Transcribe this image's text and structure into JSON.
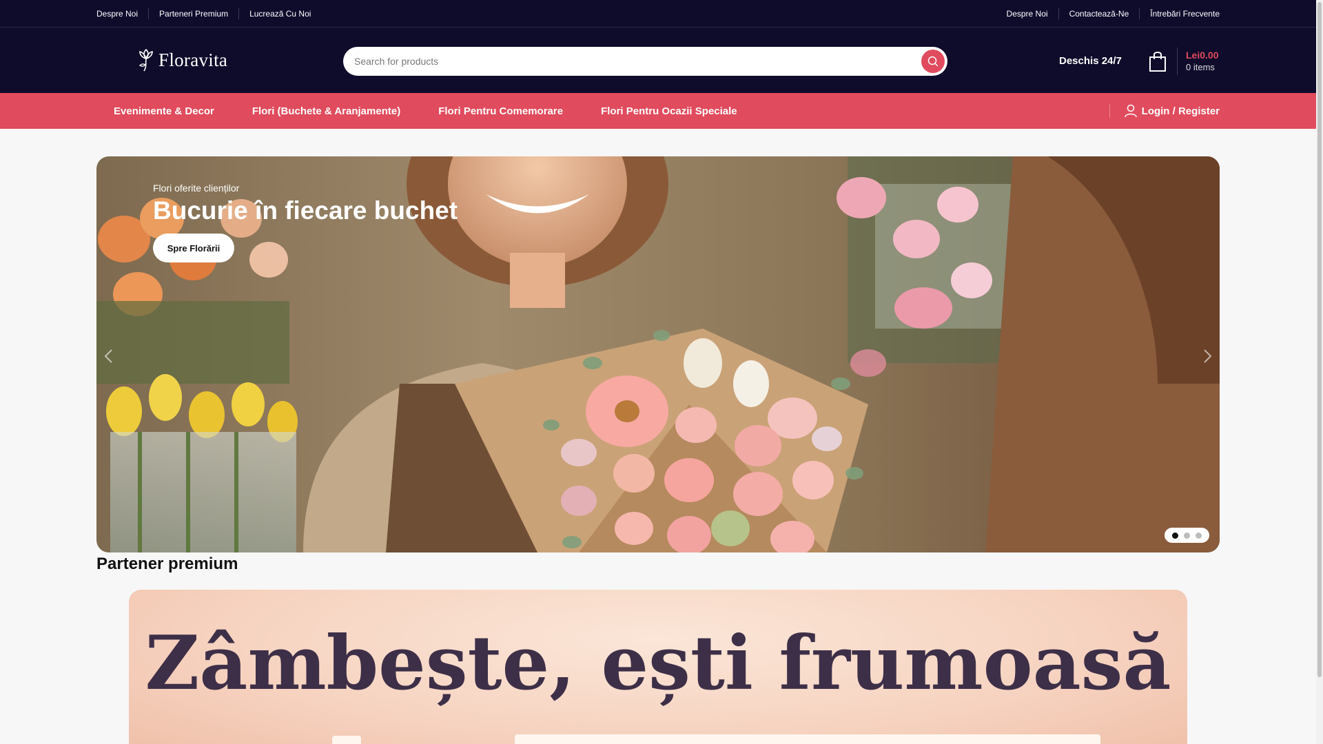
{
  "topbar": {
    "left_links": [
      "Despre Noi",
      "Parteneri Premium",
      "Lucrează Cu Noi"
    ],
    "right_links": [
      "Despre Noi",
      "Contactează-Ne",
      "Întrebări Frecvente"
    ]
  },
  "header": {
    "logo_text": "Floravita",
    "search_placeholder": "Search for products",
    "open_label": "Deschis 24/7",
    "cart_total": "Lei0.00",
    "cart_count": "0 items"
  },
  "nav": {
    "items": [
      "Evenimente & Decor",
      "Flori (Buchete & Aranjamente)",
      "Flori Pentru Comemorare",
      "Flori Pentru Ocazii Speciale"
    ],
    "login_label": "Login / Register"
  },
  "hero": {
    "kicker": "Flori oferite clienților",
    "title": "Bucurie în fiecare buchet",
    "button_label": "Spre Florării",
    "slides_total": 3,
    "active_slide": 1
  },
  "section": {
    "title": "Partener premium"
  },
  "promo": {
    "text": "Zâmbește, ești frumoasă"
  },
  "colors": {
    "header_bg": "#0e0b2b",
    "accent": "#e04b5d",
    "page_bg": "#f7f7f7"
  },
  "icons": [
    "search-icon",
    "shopping-bag-icon",
    "user-icon",
    "chevron-left-icon",
    "chevron-right-icon",
    "flower-logo-icon"
  ]
}
